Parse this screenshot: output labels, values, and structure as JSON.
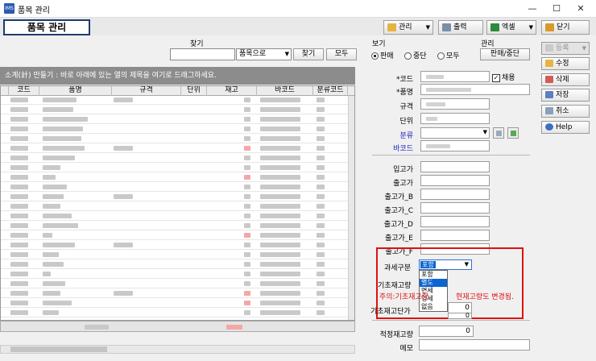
{
  "window": {
    "title": "품목 관리",
    "app_icon_text": "IMS",
    "minimize": "—",
    "maximize": "☐",
    "close": "✕"
  },
  "header": {
    "page_title": "품목 관리",
    "toolbar": {
      "manage": "관리",
      "print": "출력",
      "excel": "엑셀",
      "close": "닫기"
    }
  },
  "search": {
    "find_label": "찾기",
    "query_value": "",
    "mode_value": "품목으로",
    "find_button": "찾기",
    "all_button": "모두",
    "view_label": "보기",
    "view_options": [
      "판매",
      "중단",
      "모두"
    ],
    "view_selected": "판매",
    "manage_label": "관리",
    "manage_button": "판매/중단"
  },
  "grid": {
    "banner": "소계(計) 만들기 : 바로 아래에 있는 열의 제목을 여기로 드래그하세요.",
    "columns": [
      "코드",
      "품명",
      "규격",
      "단위",
      "재고",
      "바코드",
      "분류코드"
    ]
  },
  "detail": {
    "code_label": "*코드",
    "use_checkbox": "채용",
    "name_label": "*품명",
    "spec_label": "규격",
    "unit_label": "단위",
    "category_label": "분류",
    "barcode_label": "바코드",
    "price_labels": [
      "입고가",
      "출고가",
      "출고가_B",
      "출고가_C",
      "출고가_D",
      "출고가_E",
      "출고가_F"
    ],
    "tax_label": "과세구분",
    "tax_value": "포함",
    "tax_options": [
      "포함",
      "별도",
      "면세",
      "영세",
      "없음"
    ],
    "tax_selected": "별도",
    "opening_stock_label": "기초재고량",
    "opening_warning": "주의:기초재고량",
    "opening_warning_tail": "현재고량도 변경됨.",
    "opening_stock_value": "0",
    "opening_price_label": "기초재고단가",
    "opening_price_value": "0",
    "proper_stock_label": "적정재고량",
    "proper_stock_value": "0",
    "memo_label": "메모"
  },
  "side_buttons": {
    "register": "등록",
    "edit": "수정",
    "delete": "삭제",
    "save": "저장",
    "cancel": "취소",
    "help": "Help"
  },
  "colors": {
    "warning": "#e01010",
    "selection": "#0a64d2",
    "title_border": "#1f3c6e",
    "banner": "#8c8c8c"
  }
}
